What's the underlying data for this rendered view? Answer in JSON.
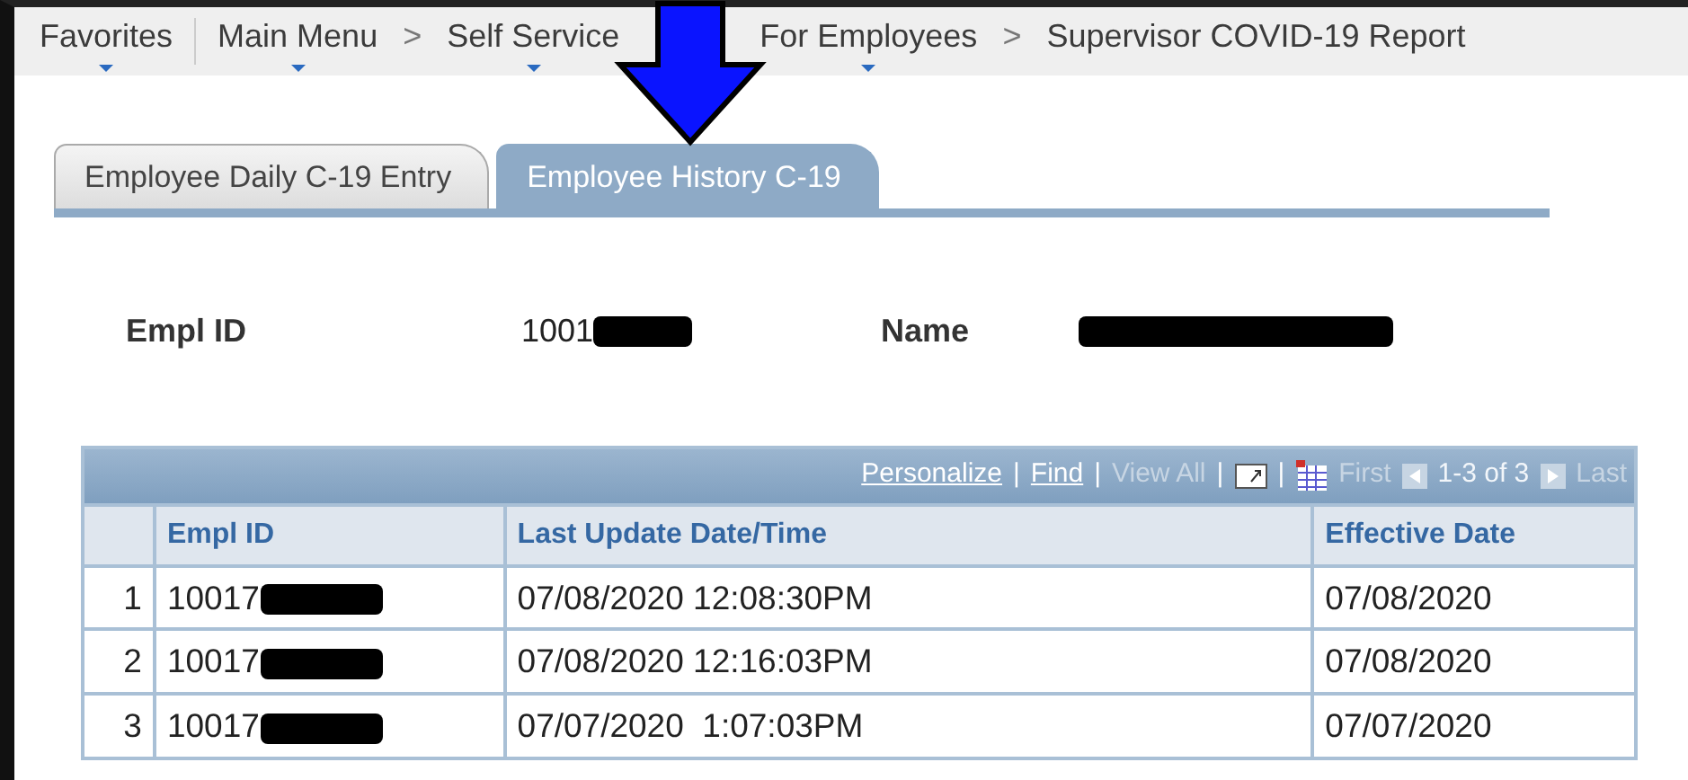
{
  "breadcrumbs": [
    {
      "kind": "link",
      "label": "Favorites",
      "has_menu": true
    },
    {
      "kind": "divider"
    },
    {
      "kind": "link",
      "label": "Main Menu",
      "has_menu": true
    },
    {
      "kind": "separator",
      "label": ">"
    },
    {
      "kind": "link",
      "label": "Self Service",
      "has_menu": true
    },
    {
      "kind": "link",
      "label": "For Employees",
      "has_menu": true
    },
    {
      "kind": "separator",
      "label": ">"
    },
    {
      "kind": "link",
      "label": "Supervisor COVID-19 Report",
      "has_menu": false
    }
  ],
  "tabs": [
    {
      "label": "Employee Daily C-19 Entry",
      "selected": false
    },
    {
      "label": "Employee History C-19",
      "selected": true
    }
  ],
  "fields": [
    {
      "label": "Empl ID",
      "value": "1001",
      "redacted": true
    },
    {
      "label": "Name",
      "redacted": true
    }
  ],
  "grid": {
    "toolbar": [
      {
        "kind": "link",
        "label": "Personalize",
        "disabled": false
      },
      {
        "kind": "bar",
        "label": "|"
      },
      {
        "kind": "link",
        "label": "Find",
        "disabled": false
      },
      {
        "kind": "bar",
        "label": "|"
      },
      {
        "kind": "link",
        "label": "View All",
        "disabled": true
      },
      {
        "kind": "bar",
        "label": "|"
      },
      {
        "kind": "zoom-icon"
      },
      {
        "kind": "bar",
        "label": "|"
      },
      {
        "kind": "grid-icon"
      },
      {
        "kind": "link",
        "label": "First",
        "disabled": true
      },
      {
        "kind": "prev-icon"
      },
      {
        "kind": "text",
        "label": "1-3 of 3"
      },
      {
        "kind": "next-icon"
      },
      {
        "kind": "link",
        "label": "Last",
        "disabled": true
      }
    ],
    "columns": [
      "Empl ID",
      "Last Update Date/Time",
      "Effective Date"
    ],
    "rows": [
      {
        "number": "1",
        "empl_id": "10017",
        "updated": "07/08/2020 12:08:30PM",
        "effective": "07/08/2020"
      },
      {
        "number": "2",
        "empl_id": "10017",
        "updated": "07/08/2020 12:16:03PM",
        "effective": "07/08/2020"
      },
      {
        "number": "3",
        "empl_id": "10017",
        "updated": "07/07/2020  1:07:03PM",
        "effective": "07/07/2020"
      }
    ]
  }
}
